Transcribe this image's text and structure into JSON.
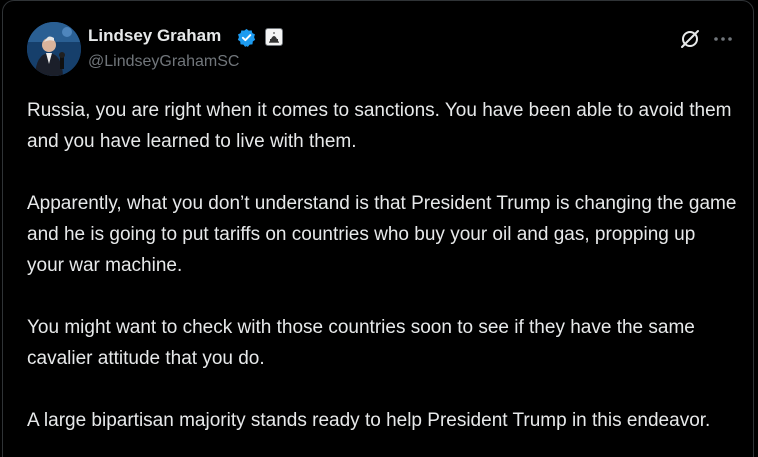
{
  "tweet": {
    "author": {
      "name": "Lindsey Graham",
      "handle": "@LindseyGrahamSC",
      "avatar_icon": "person-at-podium-avatar",
      "verified_color": "#1d9bf0"
    },
    "icons": {
      "grok": "grok-icon",
      "more": "more-icon"
    },
    "paragraphs": [
      "Russia, you are right when it comes to sanctions. You have been able to avoid them and you have learned to live with them.",
      "Apparently, what you don’t understand is that President Trump is changing the game and he is going to put tariffs on countries who buy your oil and gas, propping up your war machine.",
      "You might want to check with those countries soon to see if they have the same cavalier attitude that you do.",
      "A large bipartisan majority stands ready to help President Trump in this endeavor."
    ]
  },
  "colors": {
    "background": "#000000",
    "text_primary": "#e7e9ea",
    "text_secondary": "#71767b",
    "border": "#2f3336",
    "verified_blue": "#1d9bf0"
  }
}
